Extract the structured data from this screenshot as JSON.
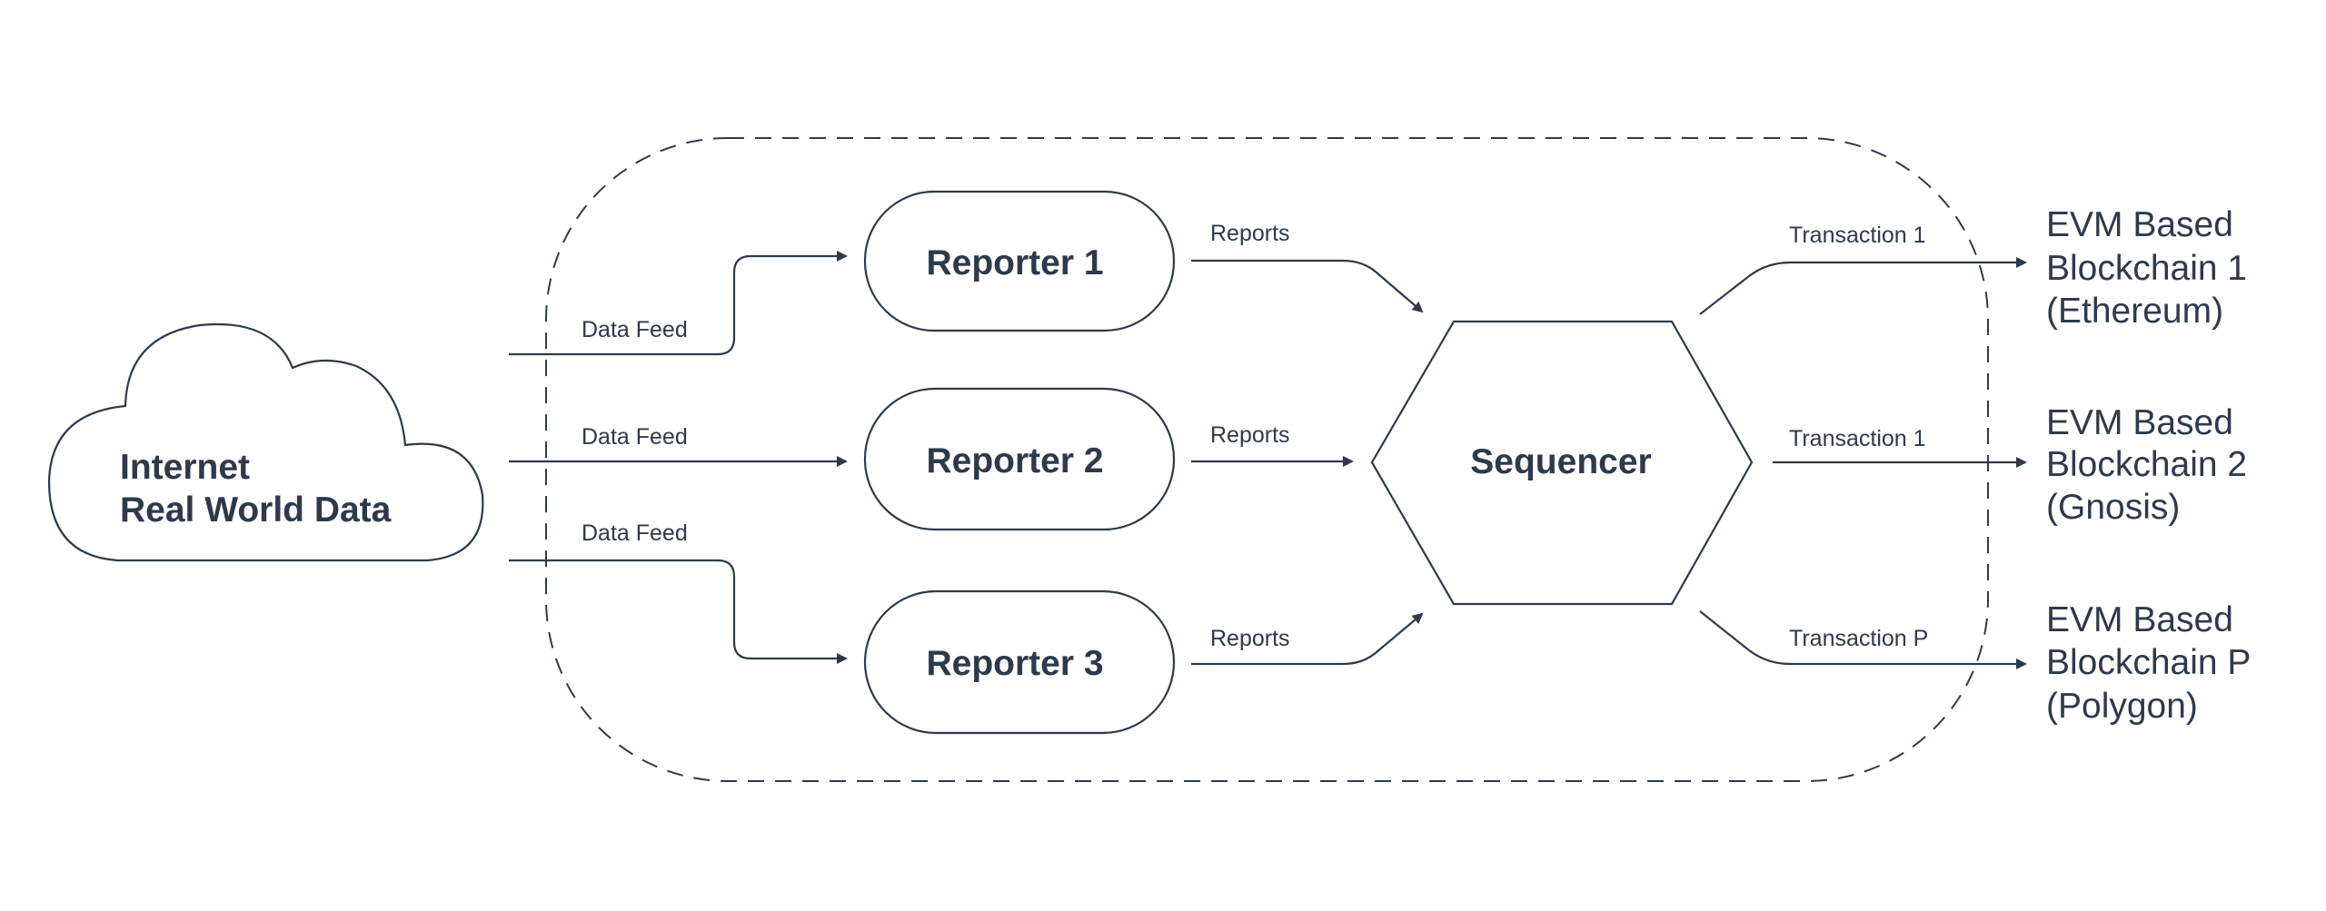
{
  "colors": {
    "stroke": "#2e3a4b",
    "background": "#ffffff"
  },
  "source": {
    "line1": "Internet",
    "line2": "Real World Data",
    "icon": "cloud-icon"
  },
  "data_feeds": [
    "Data Feed",
    "Data Feed",
    "Data Feed"
  ],
  "reporters": [
    "Reporter 1",
    "Reporter 2",
    "Reporter 3"
  ],
  "reports": [
    "Reports",
    "Reports",
    "Reports"
  ],
  "sequencer": "Sequencer",
  "transactions": [
    "Transaction 1",
    "Transaction 1",
    "Transaction P"
  ],
  "chains": [
    {
      "line1": "EVM Based",
      "line2": "Blockchain 1",
      "line3": "(Ethereum)"
    },
    {
      "line1": "EVM Based",
      "line2": "Blockchain 2",
      "line3": "(Gnosis)"
    },
    {
      "line1": "EVM Based",
      "line2": "Blockchain P",
      "line3": "(Polygon)"
    }
  ]
}
